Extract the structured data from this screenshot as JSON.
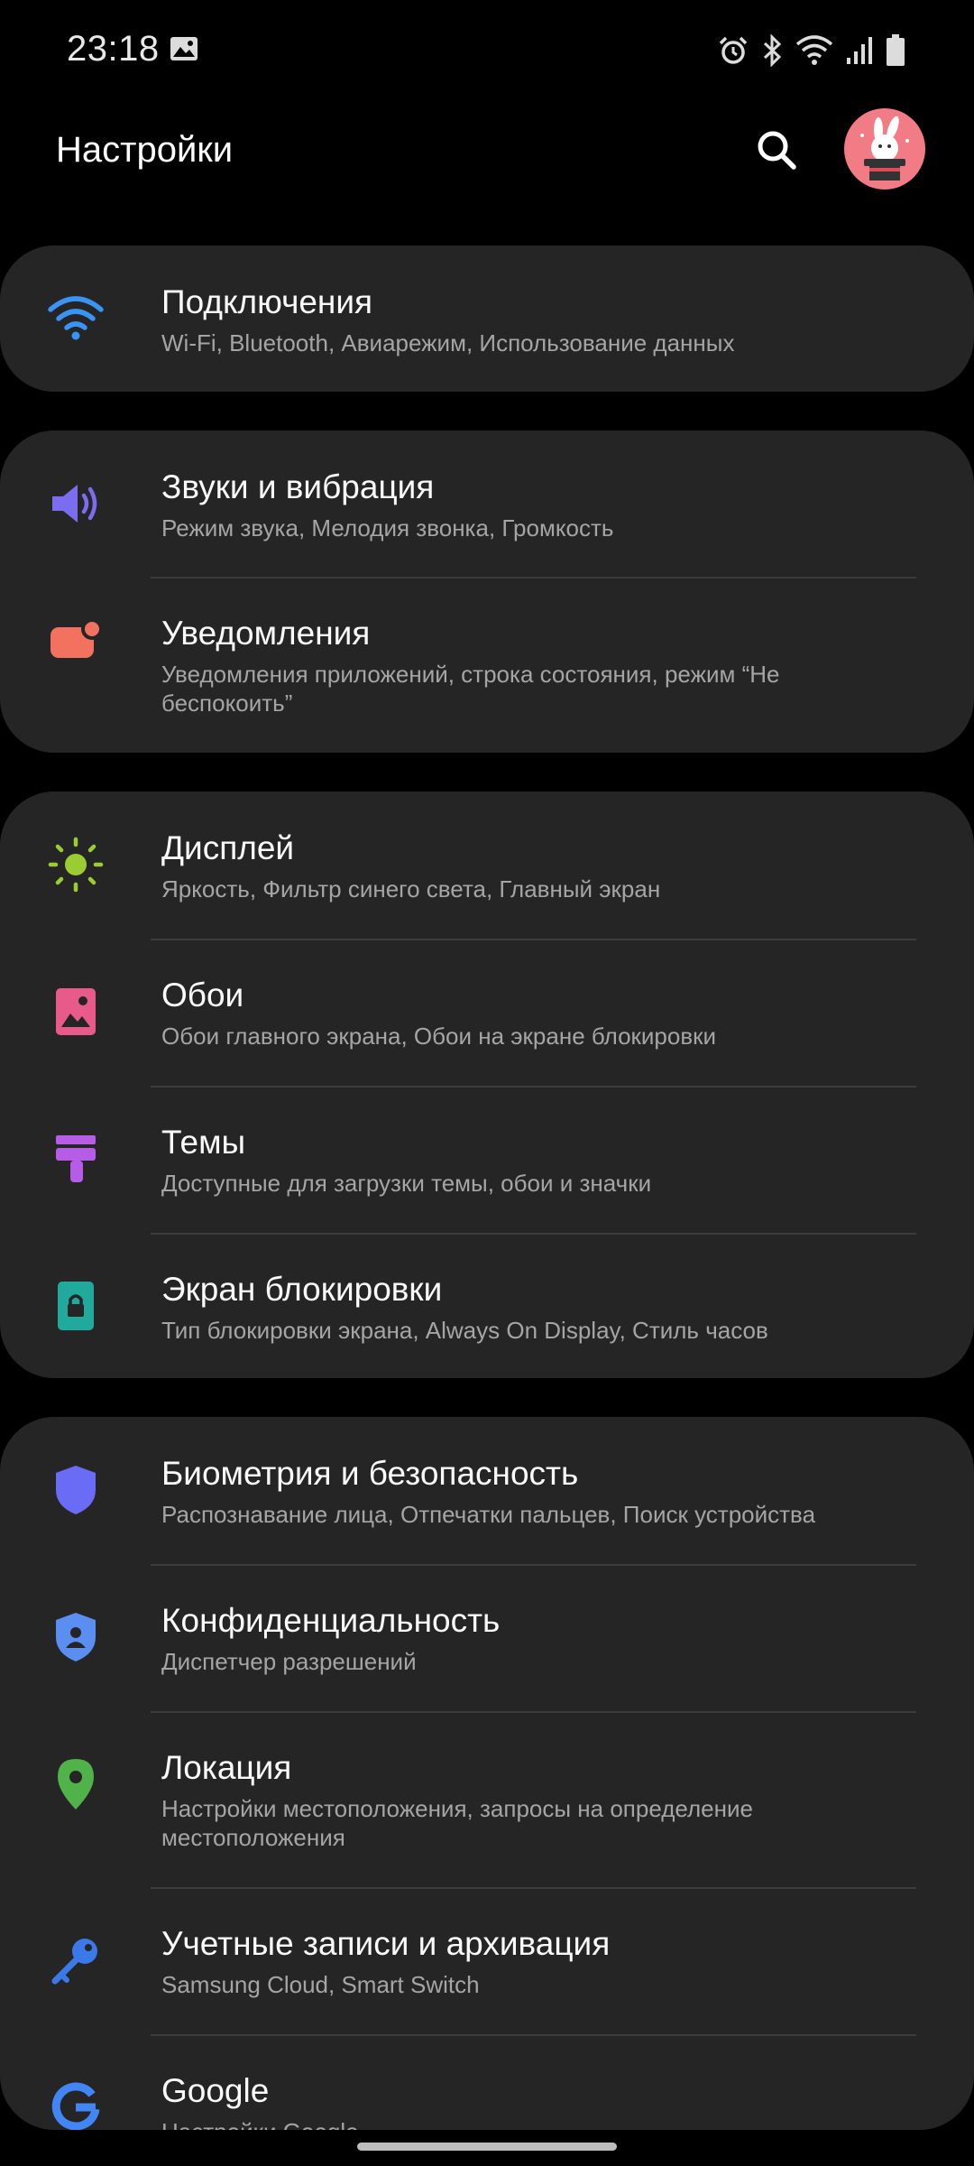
{
  "status_bar": {
    "time": "23:18"
  },
  "header": {
    "title": "Настройки"
  },
  "groups": [
    {
      "items": [
        {
          "title": "Подключения",
          "subtitle": "Wi-Fi, Bluetooth, Авиарежим, Использование данных",
          "icon": "wifi-icon",
          "icon_color": "#3a94f5"
        }
      ]
    },
    {
      "items": [
        {
          "title": "Звуки и вибрация",
          "subtitle": "Режим звука, Мелодия звонка, Громкость",
          "icon": "speaker-icon",
          "icon_color": "#7b6cf0"
        },
        {
          "title": "Уведомления",
          "subtitle": "Уведомления приложений, строка состояния, режим “Не беспокоить”",
          "icon": "notification-icon",
          "icon_color": "#f2715f"
        }
      ]
    },
    {
      "items": [
        {
          "title": "Дисплей",
          "subtitle": "Яркость, Фильтр синего света, Главный экран",
          "icon": "sun-icon",
          "icon_color": "#9acd32"
        },
        {
          "title": "Обои",
          "subtitle": "Обои главного экрана, Обои на экране блокировки",
          "icon": "wallpaper-icon",
          "icon_color": "#e85a89"
        },
        {
          "title": "Темы",
          "subtitle": "Доступные для загрузки темы, обои и значки",
          "icon": "paintbrush-icon",
          "icon_color": "#b65ce6"
        },
        {
          "title": "Экран блокировки",
          "subtitle": "Тип блокировки экрана, Always On Display, Стиль часов",
          "icon": "lock-icon",
          "icon_color": "#20a99c"
        }
      ]
    },
    {
      "items": [
        {
          "title": "Биометрия и безопасность",
          "subtitle": "Распознавание лица, Отпечатки пальцев, Поиск устройства",
          "icon": "shield-icon",
          "icon_color": "#6b6cf5"
        },
        {
          "title": "Конфиденциальность",
          "subtitle": "Диспетчер разрешений",
          "icon": "privacy-shield-icon",
          "icon_color": "#5a8ef0"
        },
        {
          "title": "Локация",
          "subtitle": "Настройки местоположения, запросы на определение местоположения",
          "icon": "location-pin-icon",
          "icon_color": "#4fb34a"
        },
        {
          "title": "Учетные записи и архивация",
          "subtitle": "Samsung Cloud, Smart Switch",
          "icon": "key-icon",
          "icon_color": "#3b78e8"
        },
        {
          "title": "Google",
          "subtitle": "Настройки Google",
          "icon": "google-icon",
          "icon_color": "#4285f4"
        }
      ]
    }
  ]
}
